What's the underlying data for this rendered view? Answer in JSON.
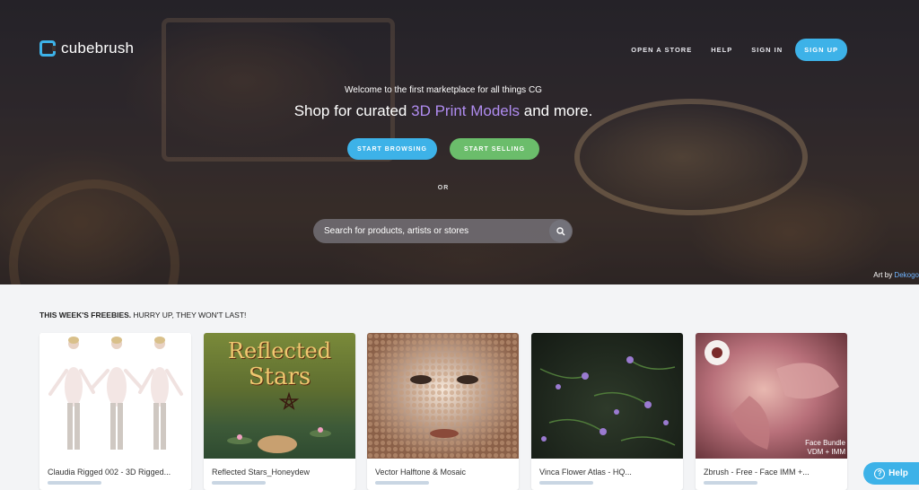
{
  "brand": {
    "name": "cubebrush",
    "accent": "#3db2e8",
    "sell_green": "#6bbd6b",
    "highlight_purple": "#b08cf0"
  },
  "nav": {
    "open_store": "OPEN A STORE",
    "help": "HELP",
    "sign_in": "SIGN IN",
    "sign_up": "SIGN UP"
  },
  "hero": {
    "welcome": "Welcome to the first marketplace for all things CG",
    "headline_pre": "Shop for curated ",
    "headline_highlight": "3D Print Models",
    "headline_post": " and more.",
    "browse_label": "START BROWSING",
    "sell_label": "START SELLING",
    "or_label": "OR",
    "credit_prefix": "Art by ",
    "credit_artist": "Dekogo"
  },
  "search": {
    "placeholder": "Search for products, artists or stores",
    "icon": "search-icon"
  },
  "freebies": {
    "title_bold": "THIS WEEK'S FREEBIES.",
    "title_rest": " HURRY UP, THEY WON'T LAST!",
    "items": [
      {
        "title": "Claudia Rigged 002 - 3D Rigged..."
      },
      {
        "title": "Reflected Stars_Honeydew",
        "art_line1": "Reflected",
        "art_line2": "Stars"
      },
      {
        "title": "Vector Halftone & Mosaic"
      },
      {
        "title": "Vinca Flower Atlas - HQ..."
      },
      {
        "title": "Zbrush - Free - Face IMM +...",
        "overlay_line1": "Face Bundle",
        "overlay_line2": "VDM + IMM"
      }
    ]
  },
  "help_widget": {
    "label": "Help",
    "icon": "question-icon"
  }
}
